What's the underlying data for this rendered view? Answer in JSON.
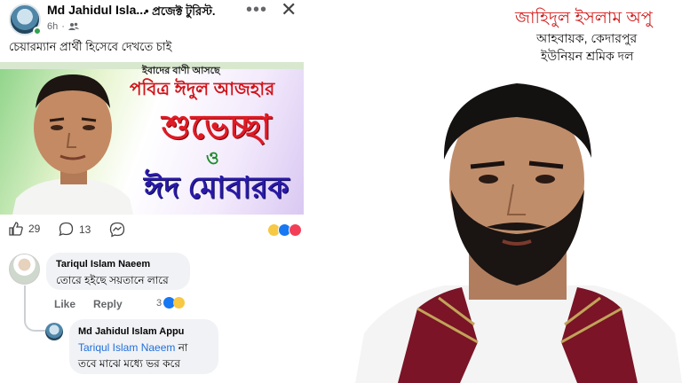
{
  "post": {
    "author": "Md Jahidul Isla...",
    "group": "• প্রজেক্ট টুরিস্ট.",
    "time": "6h",
    "text": "চেয়ারম্যান প্রার্থী হিসেবে দেখতে চাই",
    "banner": {
      "top_line": "ইবাদের বাণী আসছে",
      "line1": "পবিত্র ঈদুল আজহার",
      "line2": "শুভেচ্ছা",
      "line3": "ও",
      "line4": "ঈদ মোবারক"
    },
    "likes": "29",
    "comments": "13"
  },
  "comments": [
    {
      "name": "Tariqul Islam Naeem",
      "text": "তোরে হইছে সয়তানে লারে",
      "like_label": "Like",
      "reply_label": "Reply",
      "reaction_count": "3"
    }
  ],
  "reply": {
    "name": "Md Jahidul Islam Appu",
    "mention": "Tariqul Islam Naeem",
    "text1_suffix": "না",
    "text2": "তবে মাঝে মধ্যে ভর করে"
  },
  "profile": {
    "name": "জাহিদুল ইসলাম অপু",
    "title1": "আহবায়ক, কেদারপুর",
    "title2": "ইউনিয়ন শ্রমিক দল"
  },
  "colors": {
    "accent_red": "#d21a1a",
    "link_blue": "#216fdb",
    "online_green": "#31a24c"
  }
}
